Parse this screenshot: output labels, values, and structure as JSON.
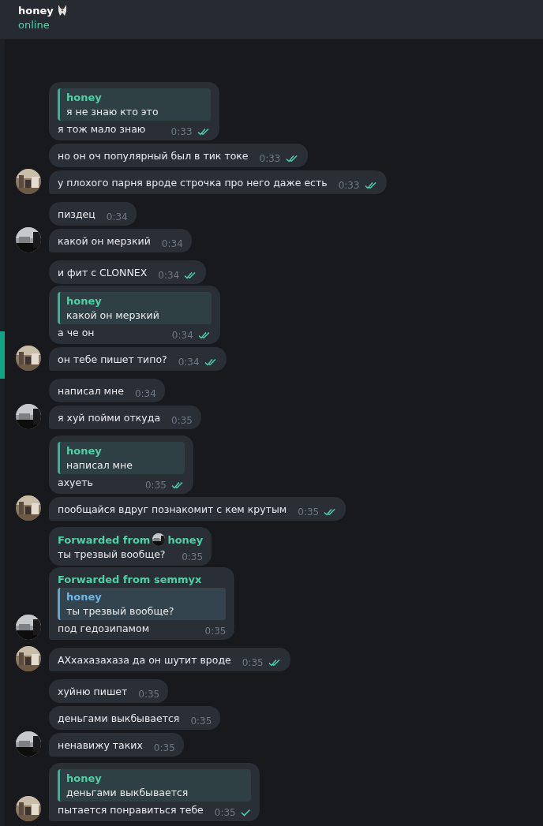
{
  "header": {
    "title": "honey",
    "status": "online"
  },
  "messages": [
    {
      "kind": "outgoing",
      "reply": {
        "kind": "own",
        "name": "honey",
        "text": "я не знаю кто это"
      },
      "text": "я тож мало знаю",
      "time": "0:33",
      "read": true,
      "avatar": false
    },
    {
      "kind": "outgoing",
      "text": "но он оч популярный был в тик токе",
      "time": "0:33",
      "read": true,
      "avatar": false
    },
    {
      "kind": "outgoing",
      "text": "у плохого парня вроде строчка про него даже есть",
      "time": "0:33",
      "read": true,
      "avatar": true
    },
    {
      "kind": "incoming",
      "text": "пиздец",
      "time": "0:34",
      "avatar": false
    },
    {
      "kind": "incoming",
      "text": "какой он мерзкий",
      "time": "0:34",
      "avatar": true
    },
    {
      "kind": "outgoing",
      "text": "и фит с CLONNEX",
      "time": "0:34",
      "read": true,
      "avatar": false
    },
    {
      "kind": "outgoing",
      "reply": {
        "kind": "own",
        "name": "honey",
        "text": "какой он мерзкий"
      },
      "text": "а че он",
      "time": "0:34",
      "read": true,
      "avatar": false
    },
    {
      "kind": "outgoing",
      "text": "он тебе пишет типо?",
      "time": "0:34",
      "read": true,
      "avatar": true
    },
    {
      "kind": "incoming",
      "text": "написал мне",
      "time": "0:34",
      "avatar": false
    },
    {
      "kind": "incoming",
      "text": "я хуй пойми откуда",
      "time": "0:35",
      "avatar": true
    },
    {
      "kind": "outgoing",
      "reply": {
        "kind": "own",
        "name": "honey",
        "text": "написал мне"
      },
      "text": "ахуеть",
      "time": "0:35",
      "read": true,
      "avatar": false
    },
    {
      "kind": "outgoing",
      "text": "пообщайся вдруг познакомит с кем крутым",
      "time": "0:35",
      "read": true,
      "avatar": true
    },
    {
      "kind": "incoming",
      "forward": {
        "label": "Forwarded from",
        "name": "honey"
      },
      "text": "ты трезвый вообще?",
      "time": "0:35",
      "avatar": false
    },
    {
      "kind": "incoming",
      "forward": {
        "label": "Forwarded from semmyx"
      },
      "reply": {
        "kind": "forwarded",
        "name": "honey",
        "text": "ты трезвый вообще?"
      },
      "text": "под гедозипамом",
      "time": "0:35",
      "avatar": true
    },
    {
      "kind": "outgoing",
      "text": "АХхахазахаза да он шутит вроде",
      "time": "0:35",
      "read": true,
      "avatar": true
    },
    {
      "kind": "incoming",
      "text": "хуйню пишет",
      "time": "0:35",
      "avatar": false
    },
    {
      "kind": "incoming",
      "text": "деньгами выкбывается",
      "time": "0:35",
      "avatar": false
    },
    {
      "kind": "incoming",
      "text": "ненавижу таких",
      "time": "0:35",
      "avatar": true
    },
    {
      "kind": "outgoing",
      "reply": {
        "kind": "own",
        "name": "honey",
        "text": "деньгами выкбывается"
      },
      "text": "пытается понравиться тебе",
      "time": "0:35",
      "read": false,
      "avatar": true
    }
  ]
}
